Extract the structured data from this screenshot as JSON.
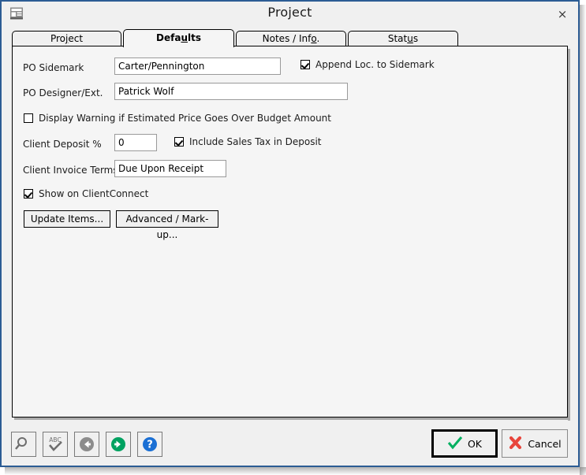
{
  "window": {
    "title": "Project",
    "icon": "form-window-icon",
    "close_label": "×",
    "accent_border": "#2c5c94"
  },
  "tabs": [
    {
      "label": "Project",
      "acc_index": 3,
      "active": false,
      "name": "tab-project"
    },
    {
      "label": "Defaults",
      "acc_index": 5,
      "active": true,
      "name": "tab-defaults"
    },
    {
      "label": "Notes / Info.",
      "acc_index": 11,
      "active": false,
      "name": "tab-notes-info"
    },
    {
      "label": "Status",
      "acc_index": 4,
      "active": false,
      "name": "tab-status"
    }
  ],
  "form": {
    "po_sidemark": {
      "label": "PO Sidemark",
      "value": "Carter/Pennington",
      "placeholder": ""
    },
    "append_loc": {
      "label": "Append Loc. to Sidemark",
      "checked": true
    },
    "po_designer": {
      "label": "PO Designer/Ext.",
      "value": "Patrick Wolf",
      "placeholder": ""
    },
    "display_warning": {
      "label": "Display Warning if Estimated Price Goes Over Budget Amount",
      "checked": false
    },
    "client_deposit": {
      "label": "Client Deposit %",
      "value": "0",
      "placeholder": ""
    },
    "include_sales_tax": {
      "label": "Include Sales Tax in Deposit",
      "checked": true
    },
    "client_invoice_terms": {
      "label": "Client Invoice Terms",
      "value": "Due Upon Receipt",
      "placeholder": ""
    },
    "show_on_clientconnect": {
      "label": "Show on ClientConnect",
      "checked": true
    },
    "update_items_button": "Update Items...",
    "advanced_markup_button": "Advanced / Mark-up..."
  },
  "toolbar": {
    "buttons": [
      {
        "name": "search-icon",
        "title": "Search"
      },
      {
        "name": "spellcheck-icon",
        "title": "Spell Check",
        "text": "ABC"
      },
      {
        "name": "back-arrow-icon",
        "title": "Previous",
        "color": "#8c8c8c"
      },
      {
        "name": "forward-arrow-icon",
        "title": "Next",
        "color": "#00a261"
      },
      {
        "name": "help-icon",
        "title": "Help",
        "text": "?",
        "color": "#1a6fd4"
      }
    ]
  },
  "dialog_buttons": {
    "ok": {
      "label": "OK",
      "icon": "check-icon",
      "color": "#00b060",
      "default": true
    },
    "cancel": {
      "label": "Cancel",
      "icon": "x-icon",
      "color": "#e8453c"
    }
  }
}
